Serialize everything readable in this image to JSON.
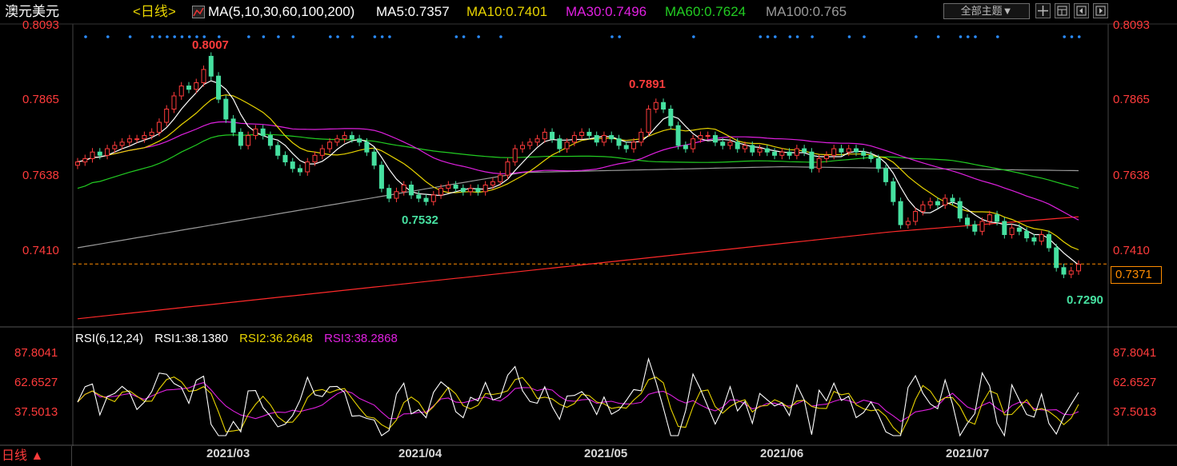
{
  "header": {
    "symbol": "澳元美元",
    "period_tag": "<日线>",
    "indicator": "MA(5,10,30,60,100,200)",
    "ma5": "MA5:0.7357",
    "ma10": "MA10:0.7401",
    "ma30": "MA30:0.7496",
    "ma60": "MA60:0.7624",
    "ma100": "MA100:0.765",
    "theme_button": "全部主题▼"
  },
  "colors": {
    "ma5": "#ffffff",
    "ma10": "#e8d400",
    "ma30": "#e020e0",
    "ma60": "#22cc22",
    "ma100": "#9a9a9a",
    "ma200": "#ff2a2a",
    "up": "#ff3b3b",
    "down": "#46e0a0",
    "last_price": "#ff8c00"
  },
  "price_axis": [
    "0.8093",
    "0.7865",
    "0.7638",
    "0.7410"
  ],
  "last_price": "0.7371",
  "annotations": {
    "high1": "0.8007",
    "high2": "0.7891",
    "low1": "0.7532",
    "low2": "0.7290"
  },
  "rsi": {
    "title": "RSI(6,12,24)",
    "rsi1": "RSI1:38.1380",
    "rsi2": "RSI2:36.2648",
    "rsi3": "RSI3:38.2868",
    "axis": [
      "87.8041",
      "62.6527",
      "37.5013"
    ]
  },
  "x_axis": [
    "2021/03",
    "2021/04",
    "2021/05",
    "2021/06",
    "2021/07"
  ],
  "period_button": "日线 ▲",
  "chart_data": {
    "type": "candlestick",
    "ylim": [
      0.719,
      0.8093
    ],
    "closes": [
      0.768,
      0.769,
      0.771,
      0.77,
      0.772,
      0.773,
      0.774,
      0.775,
      0.775,
      0.776,
      0.777,
      0.78,
      0.784,
      0.788,
      0.791,
      0.79,
      0.792,
      0.796,
      0.794,
      0.787,
      0.781,
      0.777,
      0.773,
      0.776,
      0.778,
      0.776,
      0.773,
      0.77,
      0.768,
      0.766,
      0.765,
      0.768,
      0.77,
      0.772,
      0.774,
      0.775,
      0.776,
      0.775,
      0.774,
      0.771,
      0.767,
      0.76,
      0.757,
      0.759,
      0.761,
      0.758,
      0.757,
      0.756,
      0.758,
      0.76,
      0.761,
      0.76,
      0.759,
      0.76,
      0.759,
      0.761,
      0.762,
      0.764,
      0.768,
      0.772,
      0.773,
      0.774,
      0.775,
      0.777,
      0.775,
      0.772,
      0.774,
      0.776,
      0.777,
      0.776,
      0.774,
      0.776,
      0.775,
      0.773,
      0.772,
      0.774,
      0.777,
      0.784,
      0.786,
      0.784,
      0.779,
      0.773,
      0.772,
      0.775,
      0.776,
      0.776,
      0.774,
      0.773,
      0.774,
      0.772,
      0.773,
      0.771,
      0.772,
      0.771,
      0.77,
      0.771,
      0.77,
      0.772,
      0.771,
      0.766,
      0.769,
      0.77,
      0.772,
      0.771,
      0.772,
      0.771,
      0.77,
      0.769,
      0.766,
      0.762,
      0.756,
      0.749,
      0.75,
      0.753,
      0.755,
      0.756,
      0.755,
      0.757,
      0.756,
      0.751,
      0.749,
      0.747,
      0.75,
      0.752,
      0.75,
      0.746,
      0.748,
      0.747,
      0.745,
      0.744,
      0.746,
      0.742,
      0.736,
      0.734,
      0.735,
      0.737
    ],
    "opens": [
      0.767,
      0.768,
      0.769,
      0.771,
      0.77,
      0.772,
      0.773,
      0.774,
      0.775,
      0.775,
      0.776,
      0.777,
      0.78,
      0.784,
      0.788,
      0.791,
      0.79,
      0.792,
      0.8,
      0.794,
      0.787,
      0.781,
      0.777,
      0.773,
      0.776,
      0.778,
      0.776,
      0.773,
      0.77,
      0.768,
      0.766,
      0.765,
      0.768,
      0.77,
      0.772,
      0.774,
      0.775,
      0.776,
      0.775,
      0.774,
      0.771,
      0.767,
      0.76,
      0.757,
      0.759,
      0.761,
      0.758,
      0.757,
      0.756,
      0.758,
      0.76,
      0.761,
      0.76,
      0.759,
      0.76,
      0.759,
      0.761,
      0.762,
      0.764,
      0.768,
      0.772,
      0.773,
      0.774,
      0.775,
      0.777,
      0.775,
      0.772,
      0.774,
      0.776,
      0.777,
      0.776,
      0.774,
      0.776,
      0.775,
      0.773,
      0.772,
      0.774,
      0.777,
      0.784,
      0.786,
      0.784,
      0.779,
      0.773,
      0.772,
      0.775,
      0.776,
      0.776,
      0.774,
      0.773,
      0.774,
      0.772,
      0.773,
      0.771,
      0.772,
      0.771,
      0.77,
      0.771,
      0.77,
      0.772,
      0.771,
      0.766,
      0.769,
      0.77,
      0.772,
      0.771,
      0.772,
      0.771,
      0.77,
      0.769,
      0.766,
      0.762,
      0.756,
      0.749,
      0.75,
      0.753,
      0.755,
      0.756,
      0.755,
      0.757,
      0.756,
      0.751,
      0.749,
      0.747,
      0.75,
      0.752,
      0.75,
      0.746,
      0.748,
      0.747,
      0.745,
      0.744,
      0.746,
      0.742,
      0.736,
      0.734,
      0.735
    ]
  }
}
